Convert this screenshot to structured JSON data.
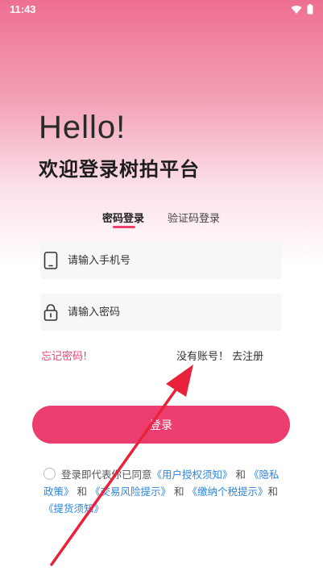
{
  "status_bar": {
    "time": "11:43",
    "icons": [
      "wifi-icon",
      "battery-icon"
    ]
  },
  "header": {
    "greeting": "Hello!",
    "subtitle": "欢迎登录树拍平台"
  },
  "tabs": [
    {
      "label": "密码登录",
      "active": true
    },
    {
      "label": "验证码登录",
      "active": false
    }
  ],
  "form": {
    "phone": {
      "placeholder": "请输入手机号",
      "value": "",
      "icon": "tablet-icon"
    },
    "password": {
      "placeholder": "请输入密码",
      "value": "",
      "icon": "lock-icon"
    },
    "forgot_label": "忘记密码!",
    "register_label": "没有账号！ 去注册",
    "login_label": "登录"
  },
  "agreement": {
    "checked": false,
    "prefix": "登录即代表你已同意",
    "link_user": "《用户授权须知》",
    "and1": "和",
    "link_privacy": "《隐私政策》",
    "and2": "和",
    "link_risk": "《交易风险提示》",
    "and3": "和",
    "link_tax": "《缴纳个税提示》",
    "and4": "和",
    "link_pickup": "《提货须知》"
  },
  "colors": {
    "accent": "#ec3e6e",
    "link": "#2d86e6",
    "annotation_arrow": "#e8223a"
  }
}
